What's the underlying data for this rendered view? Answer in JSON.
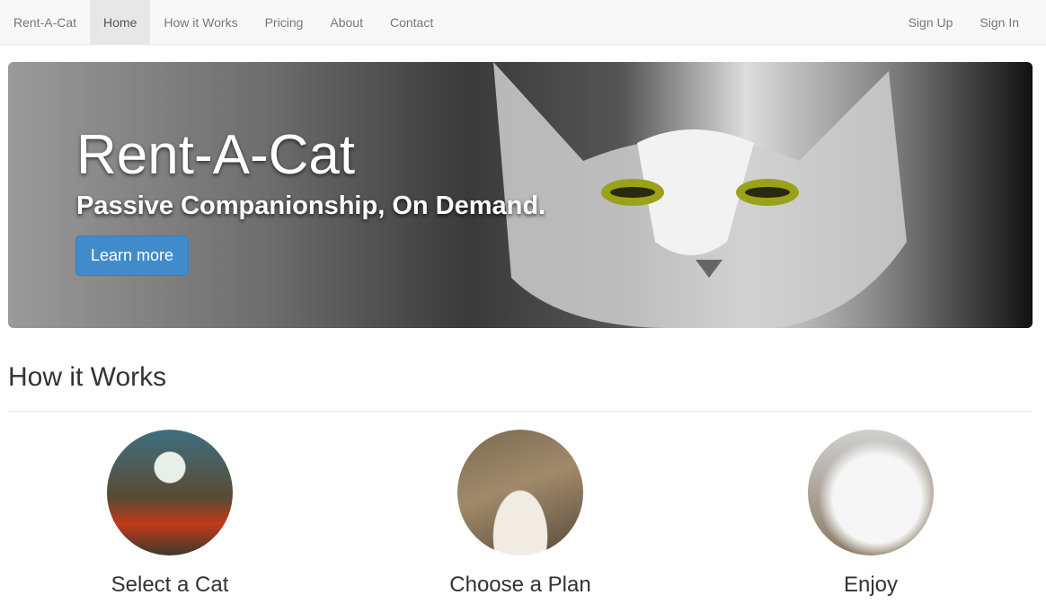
{
  "navbar": {
    "brand": "Rent-A-Cat",
    "items": [
      {
        "label": "Home",
        "active": true
      },
      {
        "label": "How it Works"
      },
      {
        "label": "Pricing"
      },
      {
        "label": "About"
      },
      {
        "label": "Contact"
      }
    ],
    "right": [
      {
        "label": "Sign Up"
      },
      {
        "label": "Sign In"
      }
    ]
  },
  "hero": {
    "title": "Rent-A-Cat",
    "subtitle": "Passive Companionship, On Demand.",
    "button": "Learn more"
  },
  "how": {
    "title": "How it Works",
    "steps": [
      {
        "label": "Select a Cat"
      },
      {
        "label": "Choose a Plan"
      },
      {
        "label": "Enjoy"
      }
    ]
  },
  "colors": {
    "primary": "#428bca"
  }
}
